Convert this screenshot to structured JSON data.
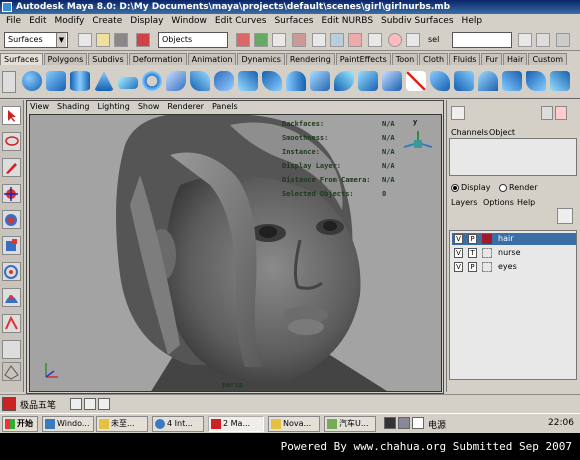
{
  "window": {
    "title": "Autodesk Maya 8.0: D:\\My Documents\\maya\\projects\\default\\scenes\\girl\\girlnurbs.mb"
  },
  "menubar": {
    "items": [
      "File",
      "Edit",
      "Modify",
      "Create",
      "Display",
      "Window",
      "Edit Curves",
      "Surfaces",
      "Edit NURBS",
      "Subdiv Surfaces",
      "Help"
    ]
  },
  "statusline": {
    "mode_value": "Surfaces",
    "object_field": "Objects",
    "sel_label": "sel",
    "input_value": ""
  },
  "shelf": {
    "tabs": [
      "Surfaces",
      "Polygons",
      "Subdivs",
      "Deformation",
      "Animation",
      "Dynamics",
      "Rendering",
      "PaintEffects",
      "Toon",
      "Cloth",
      "Fluids",
      "Fur",
      "Hair",
      "Custom"
    ],
    "active_tab": "Surfaces"
  },
  "panel": {
    "menu": [
      "View",
      "Shading",
      "Lighting",
      "Show",
      "Renderer",
      "Panels"
    ]
  },
  "hud": {
    "rows": [
      {
        "label": "Backfaces:",
        "value": "N/A"
      },
      {
        "label": "Smoothness:",
        "value": "N/A"
      },
      {
        "label": "Instance:",
        "value": "N/A"
      },
      {
        "label": "Display Layer:",
        "value": "N/A"
      },
      {
        "label": "Distance From Camera:",
        "value": "N/A"
      },
      {
        "label": "Selected Objects:",
        "value": "0"
      }
    ],
    "camera_name": "persp",
    "axis_y": "y"
  },
  "rightpanel": {
    "tabs": [
      "Channels",
      "Object"
    ],
    "display_radio": "Display",
    "render_radio": "Render",
    "layer_menu": [
      "Layers",
      "Options",
      "Help"
    ],
    "layers": [
      {
        "v": "V",
        "t": "P",
        "name": "hair",
        "color": "#a01a2a",
        "selected": true
      },
      {
        "v": "V",
        "t": "T",
        "name": "nurse",
        "color": "",
        "selected": false
      },
      {
        "v": "V",
        "t": "P",
        "name": "eyes",
        "color": "",
        "selected": false
      }
    ]
  },
  "bottom": {
    "ime_label": "极品五笔"
  },
  "taskbar": {
    "start": "开始",
    "buttons": [
      "Windo...",
      "未至...",
      "4 Int...",
      "2 Ma...",
      "Nova...",
      "汽车U..."
    ],
    "tray_label": "电源",
    "clock": "22:06"
  },
  "footer": {
    "text": "Powered By www.chahua.org  Submitted Sep 2007"
  },
  "colors": {
    "viewport_bg": "#a3a3a3",
    "hud_text": "#1b3b1b",
    "selected_layer": "#3a6ea5"
  }
}
